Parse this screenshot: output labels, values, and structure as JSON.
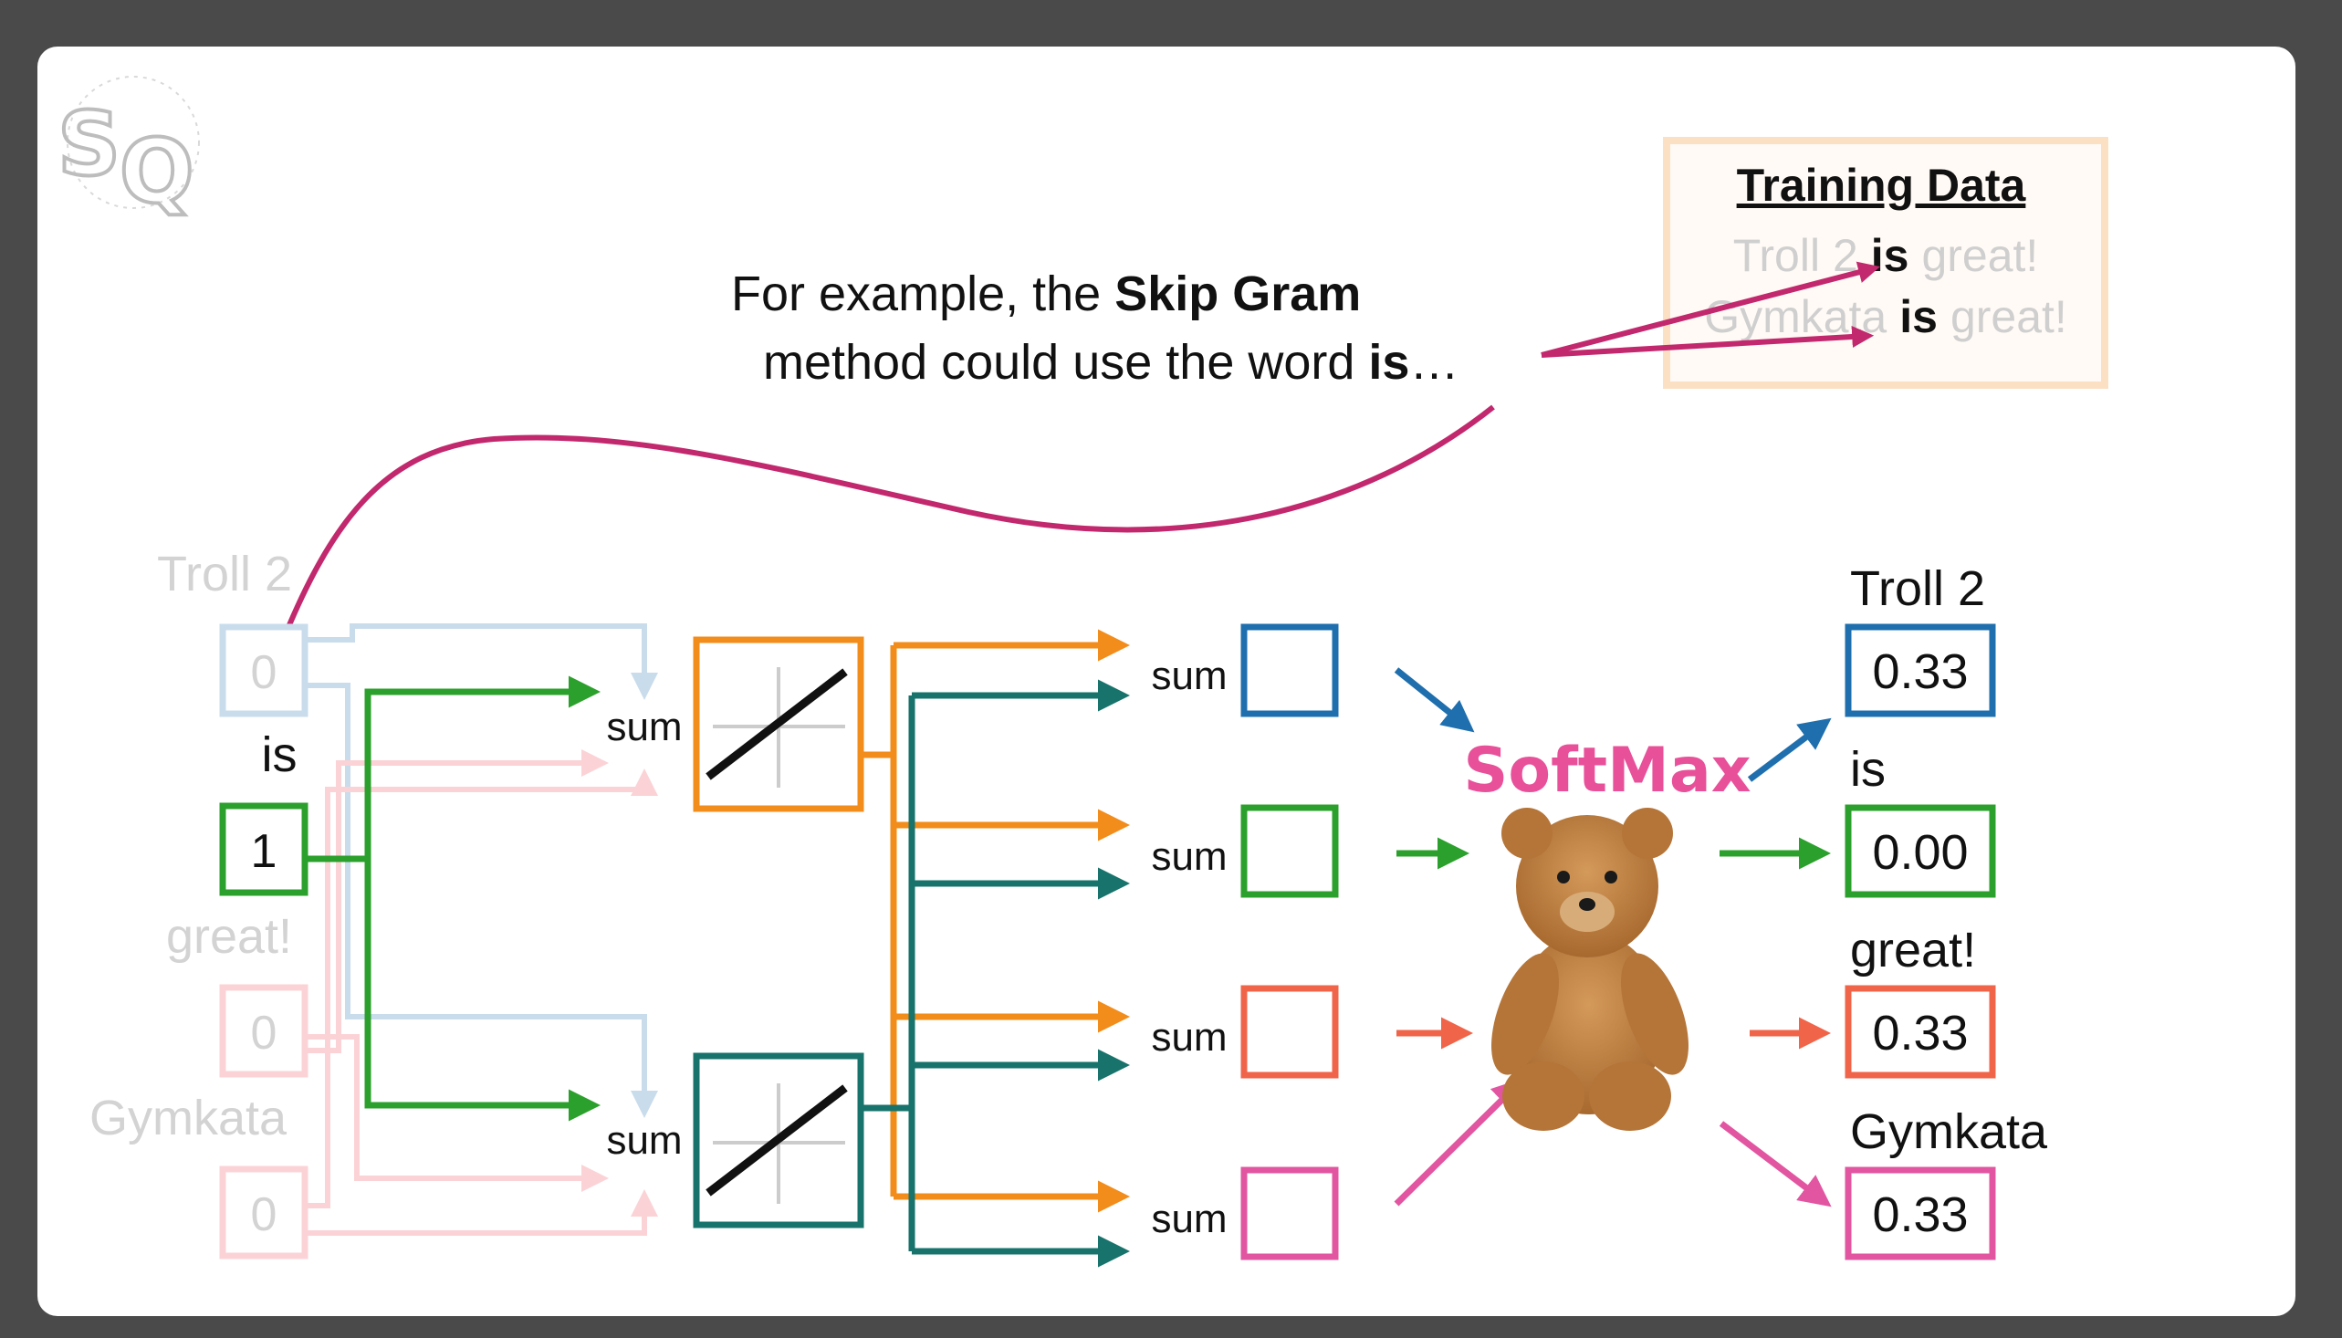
{
  "caption": {
    "line1_pre": "For example, the ",
    "line1_bold": "Skip Gram",
    "line2_pre": "method could use the word ",
    "line2_bold": "is",
    "line2_post": "…"
  },
  "training_data": {
    "title": "Training Data",
    "rows": [
      {
        "left": "Troll 2",
        "word": "is",
        "right": "great!"
      },
      {
        "left": "Gymkata",
        "word": "is",
        "right": "great!"
      }
    ]
  },
  "inputs": [
    {
      "label": "Troll 2",
      "value": "0",
      "active": false
    },
    {
      "label": "is",
      "value": "1",
      "active": true
    },
    {
      "label": "great!",
      "value": "0",
      "active": false
    },
    {
      "label": "Gymkata",
      "value": "0",
      "active": false
    }
  ],
  "hidden_sum_label": "sum",
  "output_sum_label": "sum",
  "softmax_label": "SoftMax",
  "outputs": [
    {
      "label": "Troll 2",
      "value": "0.33",
      "color": "#1f6fae"
    },
    {
      "label": "is",
      "value": "0.00",
      "color": "#2ca02c"
    },
    {
      "label": "great!",
      "value": "0.33",
      "color": "#f06449"
    },
    {
      "label": "Gymkata",
      "value": "0.33",
      "color": "#e255a1"
    }
  ],
  "colors": {
    "orange": "#f28c1a",
    "teal": "#17736b",
    "green": "#2ca02c",
    "light_blue": "#c9dcec",
    "light_pink": "#fbd3d6",
    "magenta": "#c2286d",
    "softmax_pink": "#e8509a"
  },
  "icons": [
    "statquest-logo-icon",
    "teddy-bear-icon"
  ]
}
